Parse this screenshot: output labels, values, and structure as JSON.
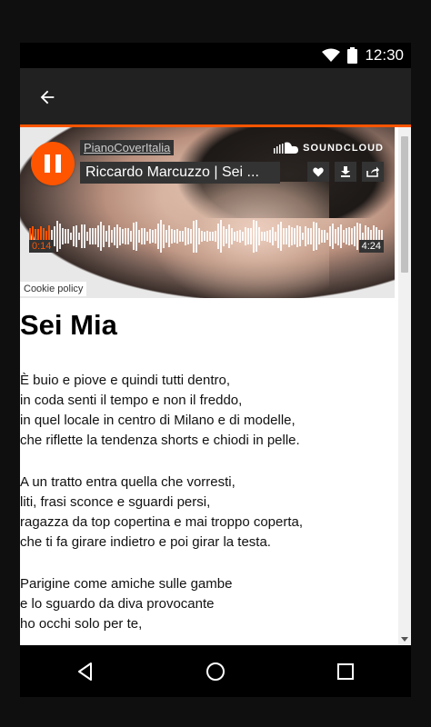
{
  "status_bar": {
    "time": "12:30"
  },
  "player": {
    "user": "PianoCoverItalia",
    "track_title": "Riccardo Marcuzzo | Sei ...",
    "brand": "SOUNDCLOUD",
    "current_time": "0:14",
    "duration": "4:24",
    "progress_fraction": 0.06,
    "cookie_policy": "Cookie policy",
    "accent_color": "#ff5500"
  },
  "lyrics": {
    "title": "Sei Mia",
    "stanzas": [
      "È buio e piove e quindi tutti dentro,\nin coda senti il tempo e non il freddo,\nin quel locale in centro di Milano e di modelle,\nche riflette la tendenza shorts e chiodi in pelle.",
      "A un tratto entra quella che vorresti,\nliti, frasi sconce e sguardi persi,\nragazza da top copertina e mai troppo coperta,\nche ti fa girare indietro e poi girar la testa.",
      "Parigine come amiche sulle gambe\ne lo sguardo da diva provocante\nho occhi solo per te,"
    ]
  },
  "icons": {
    "back": "arrow-left-icon",
    "wifi": "wifi-icon",
    "battery": "battery-icon",
    "pause": "pause-icon",
    "like": "heart-icon",
    "download": "download-icon",
    "share": "share-icon",
    "nav_back": "triangle-back-icon",
    "nav_home": "circle-home-icon",
    "nav_recents": "square-recents-icon"
  }
}
